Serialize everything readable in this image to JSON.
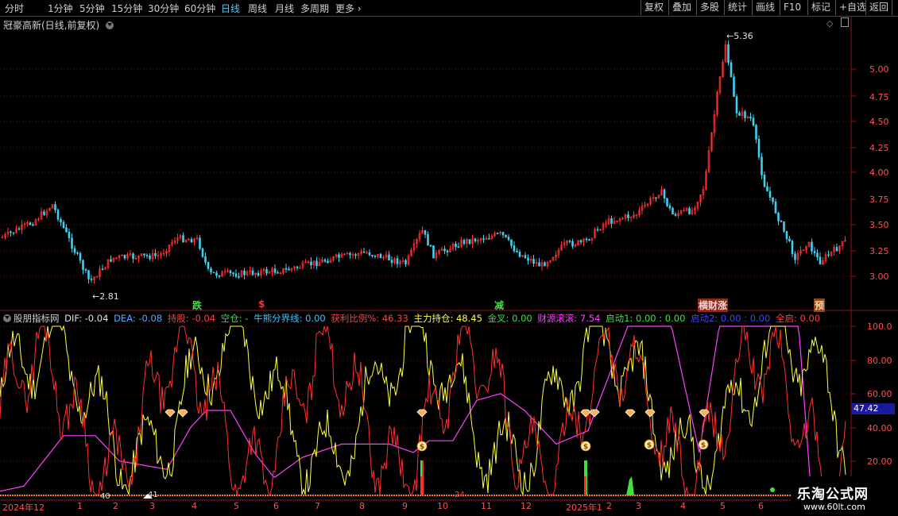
{
  "toolbar": {
    "periods": [
      "分时",
      "1分钟",
      "5分钟",
      "15分钟",
      "30分钟",
      "60分钟",
      "日线",
      "周线",
      "月线",
      "多周期",
      "更多"
    ],
    "active_period": "日线",
    "right_buttons": [
      "复权",
      "叠加",
      "多股",
      "统计",
      "画线",
      "F10",
      "标记",
      "+自选",
      "返回"
    ]
  },
  "price_panel": {
    "title": "冠豪高新(日线,前复权)",
    "y_ticks": [
      "5.00",
      "4.75",
      "4.50",
      "4.25",
      "4.00",
      "3.75",
      "3.50",
      "3.25",
      "3.00"
    ],
    "high_label": "5.36",
    "low_label": "2.81",
    "signals": [
      {
        "text": "跌",
        "color": "#40e040"
      },
      {
        "text": "$",
        "color": "#ff3030"
      },
      {
        "text": "减",
        "color": "#40e040"
      },
      {
        "text": "横财涨",
        "color": "#ffd0d0"
      },
      {
        "text": "预",
        "color": "#ffb040"
      }
    ]
  },
  "indicator_panel": {
    "name": "股朋指标网",
    "legend": [
      {
        "label": "DIF: -0.04",
        "color": "#e0e0e0"
      },
      {
        "label": "DEA: -0.08",
        "color": "#58a8ff"
      },
      {
        "label": "持股: -0.04",
        "color": "#ff4040"
      },
      {
        "label": "空仓: -",
        "color": "#40e040"
      },
      {
        "label": "牛熊分界线: 0.00",
        "color": "#40c0ff"
      },
      {
        "label": "获利比例%: 46.33",
        "color": "#ff4040"
      },
      {
        "label": "主力持仓: 48.45",
        "color": "#ffff40"
      },
      {
        "label": "金叉: 0.00",
        "color": "#40e040"
      },
      {
        "label": "财源滚滚: 7.54",
        "color": "#ff40ff"
      },
      {
        "label": "启动1: 0.00 : 0.00",
        "color": "#40e040"
      },
      {
        "label": "启动2: 0.00 : 0.00",
        "color": "#4040ff"
      },
      {
        "label": "全启: 0.00",
        "color": "#ff4040"
      }
    ],
    "y_ticks": [
      "100.0",
      "80.00",
      "60.00",
      "40.00",
      "20.00"
    ],
    "current_value": "47.42",
    "bottom_labels": [
      "40",
      "41",
      "24"
    ]
  },
  "x_axis": [
    "2024年12",
    "1",
    "2",
    "3",
    "4",
    "5",
    "6",
    "7",
    "8",
    "9",
    "10",
    "11",
    "12",
    "2025年1",
    "2",
    "3",
    "4",
    "5",
    "6"
  ],
  "watermark": {
    "title": "乐淘公式网",
    "url": "www.60lt.com"
  },
  "colors": {
    "up": "#ff3030",
    "down": "#40d0f0",
    "grid": "#5a1010",
    "ma": "#ff40ff",
    "yellow": "#ffff40"
  }
}
